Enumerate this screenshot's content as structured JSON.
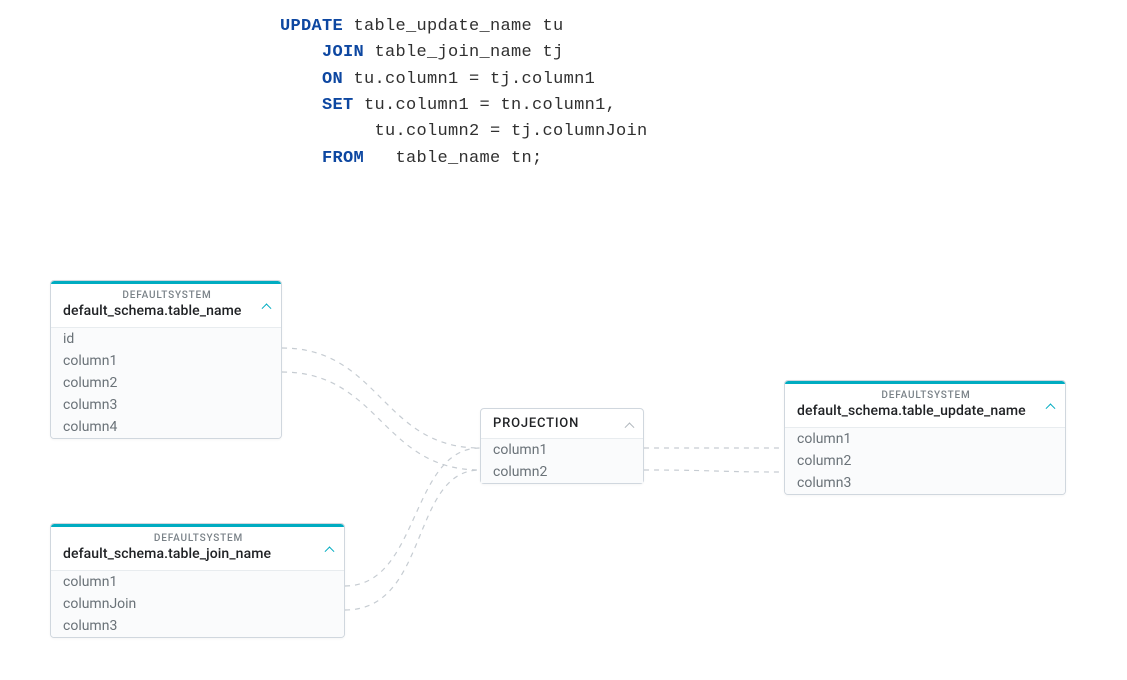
{
  "sql": {
    "l1": {
      "kw": "UPDATE",
      "rest": " table_update_name tu"
    },
    "l2": {
      "kw": "JOIN",
      "rest": " table_join_name tj"
    },
    "l3": {
      "kw": "ON",
      "rest": " tu.column1 = tj.column1"
    },
    "l4": {
      "kw": "SET",
      "rest": " tu.column1 = tn.column1,"
    },
    "l5": {
      "rest": "tu.column2 = tj.columnJoin"
    },
    "l6": {
      "kw": "FROM",
      "rest": "   table_name tn;"
    }
  },
  "nodes": {
    "table_name": {
      "system": "DEFAULTSYSTEM",
      "title": "default_schema.table_name",
      "cols": {
        "c0": "id",
        "c1": "column1",
        "c2": "column2",
        "c3": "column3",
        "c4": "column4"
      }
    },
    "table_join_name": {
      "system": "DEFAULTSYSTEM",
      "title": "default_schema.table_join_name",
      "cols": {
        "c0": "column1",
        "c1": "columnJoin",
        "c2": "column3"
      }
    },
    "projection": {
      "title": "PROJECTION",
      "cols": {
        "c0": "column1",
        "c1": "column2"
      }
    },
    "table_update_name": {
      "system": "DEFAULTSYSTEM",
      "title": "default_schema.table_update_name",
      "cols": {
        "c0": "column1",
        "c1": "column2",
        "c2": "column3"
      }
    }
  }
}
